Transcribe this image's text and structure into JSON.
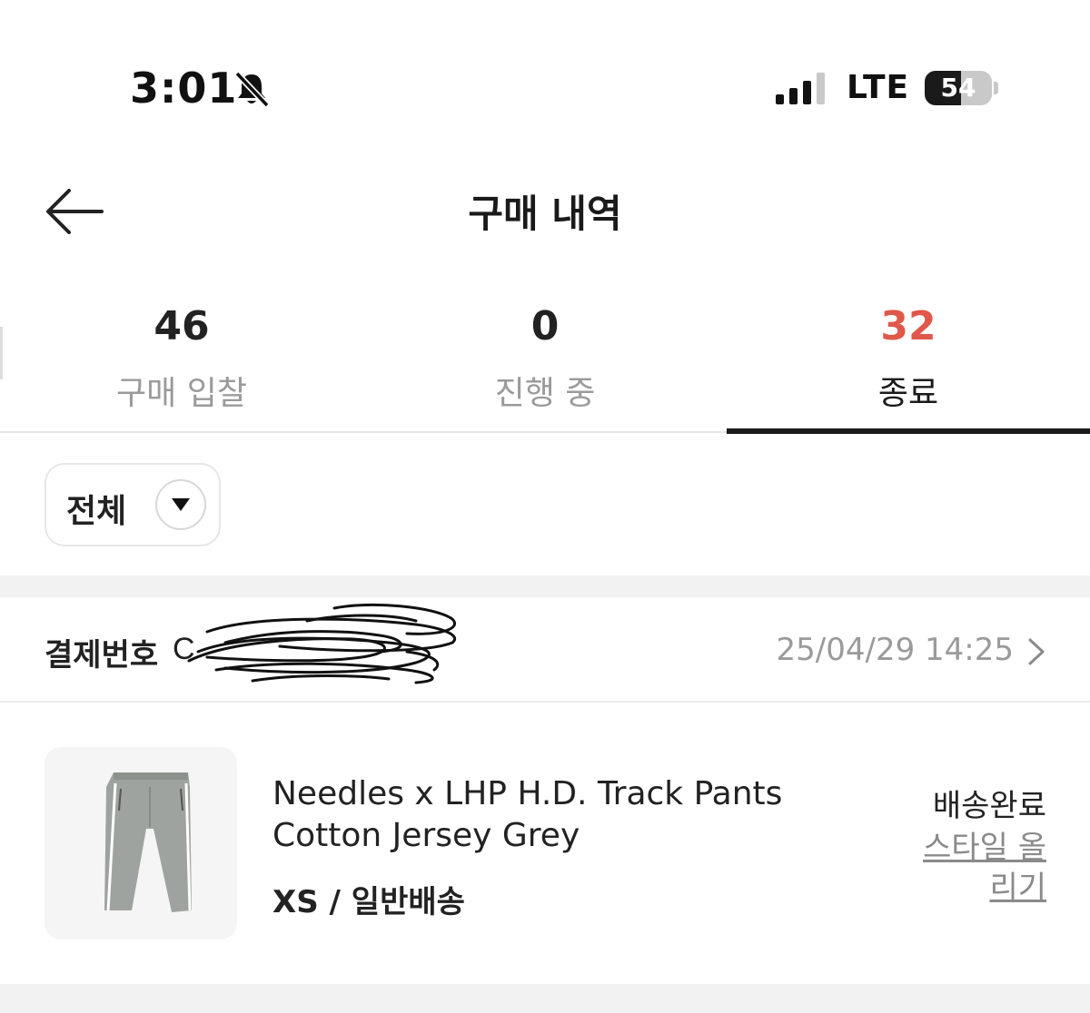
{
  "status_bar": {
    "time": "3:01",
    "network": "LTE",
    "battery_level": "54",
    "battery_fraction": 0.54,
    "signal_bars": 3
  },
  "header": {
    "title": "구매 내역",
    "back_icon": "arrow-left-icon"
  },
  "tabs": [
    {
      "count": "46",
      "label": "구매 입찰",
      "active": false
    },
    {
      "count": "0",
      "label": "진행 중",
      "active": false
    },
    {
      "count": "32",
      "label": "종료",
      "active": true
    }
  ],
  "filter": {
    "selected": "전체",
    "icon": "chevron-down-icon"
  },
  "order": {
    "payment_label": "결제번호",
    "payment_prefix": "C",
    "date": "25/04/29 14:25",
    "item": {
      "name": "Needles x LHP H.D. Track Pants Cotton Jersey Grey",
      "option": "XS / 일반배송",
      "status": "배송완료",
      "action": "스타일 올리기"
    }
  },
  "colors": {
    "accent": "#e0584a",
    "text": "#222222",
    "muted": "#9a9a9a",
    "divider": "#e6e6e6"
  }
}
